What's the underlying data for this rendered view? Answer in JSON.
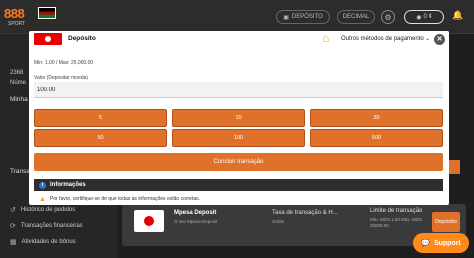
{
  "topbar": {
    "logo": "888",
    "logo_sub": "SPORT",
    "deposit_label": "DEPÓSITO",
    "decimal_label": "DECIMAL",
    "account_balance": "0 ¢"
  },
  "sidebar": {
    "fragments": [
      "2368",
      "Núme",
      "Minha",
      "Transa"
    ],
    "items": [
      {
        "label": "Histórico de pedidos",
        "icon": "history-icon"
      },
      {
        "label": "Transações financeiras",
        "icon": "refresh-icon"
      },
      {
        "label": "Atividades de bônus",
        "icon": "gift-icon"
      }
    ]
  },
  "method_card": {
    "name": "Mpesa Deposit",
    "name_sub": "O seu Mpesa Deposit",
    "fee_label": "Taxa de transação & H...",
    "fee_sub": "Grátis",
    "limit_label": "Limite de transação",
    "limit_min": "Mín. MZN 1.00 Máx. MZN",
    "limit_max": "25000.00",
    "button": "Depósito"
  },
  "support_label": "Support",
  "modal": {
    "title": "Depósito",
    "other_methods": "Outros métodos de pagamento",
    "limits": "Min: 1.00 / Max: 25,000.00",
    "amount_label": "Valor (Depositar moeda)",
    "amount_value": "100.00",
    "amounts": [
      "5",
      "10",
      "30",
      "50",
      "100",
      "500"
    ],
    "submit_label": "Concluir transação",
    "info_title": "Informações",
    "info_note": "Por favor, certifique-se de que todas as informações estão corretas."
  },
  "colors": {
    "accent": "#e0712b",
    "support": "#ff8a1a",
    "brand_red": "#e60000"
  }
}
